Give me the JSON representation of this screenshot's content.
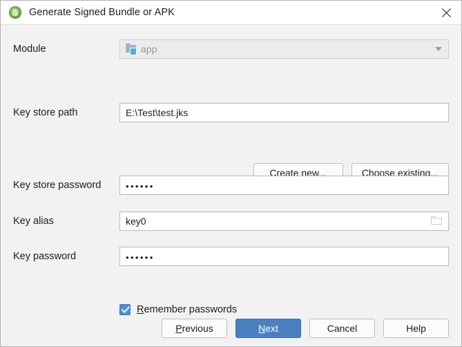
{
  "window": {
    "title": "Generate Signed Bundle or APK",
    "app_icon": "android-studio-icon",
    "close_icon": "close-icon"
  },
  "form": {
    "module": {
      "label": "Module",
      "value": "app",
      "icon": "module-folder-icon",
      "dropdown_icon": "chevron-down-icon",
      "disabled": true
    },
    "key_store_path": {
      "label": "Key store path",
      "value": "E:\\Test\\test.jks",
      "placeholder": ""
    },
    "key_store_password": {
      "label": "Key store password",
      "value": "••••••",
      "masked_length": 6
    },
    "key_alias": {
      "label": "Key alias",
      "value": "key0",
      "browse_icon": "folder-icon"
    },
    "key_password": {
      "label": "Key password",
      "value": "••••••",
      "masked_length": 6
    },
    "remember": {
      "label_before": "",
      "mnemonic": "R",
      "label_after": "emember passwords",
      "full_label": "Remember passwords",
      "checked": true,
      "check_icon": "checkmark-icon"
    }
  },
  "keystore_buttons": [
    {
      "name": "create-new",
      "before": "",
      "mnemonic": "C",
      "after": "reate new...",
      "full": "Create new..."
    },
    {
      "name": "choose-existing",
      "before": "C",
      "mnemonic": "h",
      "after": "oose existing...",
      "full": "Choose existing..."
    }
  ],
  "footer_buttons": [
    {
      "name": "previous",
      "before": "",
      "mnemonic": "P",
      "after": "revious",
      "full": "Previous",
      "primary": false
    },
    {
      "name": "next",
      "before": "",
      "mnemonic": "N",
      "after": "ext",
      "full": "Next",
      "primary": true
    },
    {
      "name": "cancel",
      "before": "Cancel",
      "mnemonic": "",
      "after": "",
      "full": "Cancel",
      "primary": false
    },
    {
      "name": "help",
      "before": "Help",
      "mnemonic": "",
      "after": "",
      "full": "Help",
      "primary": false
    }
  ],
  "colors": {
    "dialog_background": "#f2f2f2",
    "titlebar_background": "#ffffff",
    "field_background": "#ffffff",
    "field_border": "#b8b8b8",
    "primary_button": "#4a80c0",
    "checkbox_checked": "#4a90d9",
    "text": "#1d1d1d",
    "disabled_text": "#9a9a9a",
    "app_icon_green": "#7ab648",
    "module_chip_blue": "#4aaee0"
  }
}
